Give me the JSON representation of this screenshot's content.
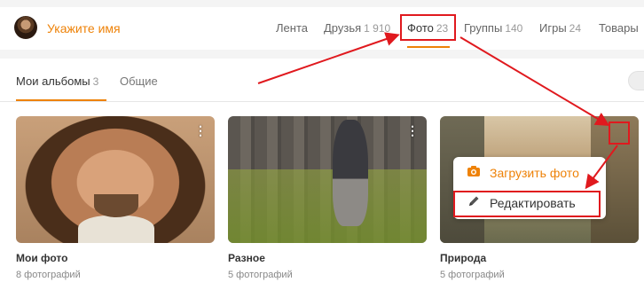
{
  "header": {
    "username": "Укажите имя",
    "nav": [
      {
        "label": "Лента",
        "count": ""
      },
      {
        "label": "Друзья",
        "count": "1 910"
      },
      {
        "label": "Фото",
        "count": "23"
      },
      {
        "label": "Группы",
        "count": "140"
      },
      {
        "label": "Игры",
        "count": "24"
      },
      {
        "label": "Товары",
        "count": ""
      }
    ]
  },
  "tabs": [
    {
      "label": "Мои альбомы",
      "count": "3"
    },
    {
      "label": "Общие",
      "count": ""
    }
  ],
  "albums": [
    {
      "title": "Мои фото",
      "count": "8 фотографий"
    },
    {
      "title": "Разное",
      "count": "5 фотографий"
    },
    {
      "title": "Природа",
      "count": "5 фотографий"
    }
  ],
  "menu": {
    "upload_label": "Загрузить фото",
    "edit_label": "Редактировать",
    "upload_icon": "camera-icon",
    "edit_icon": "pencil-icon"
  },
  "kebab_glyph": "⋮",
  "colors": {
    "accent": "#ee8208",
    "highlight": "#e0191e"
  }
}
